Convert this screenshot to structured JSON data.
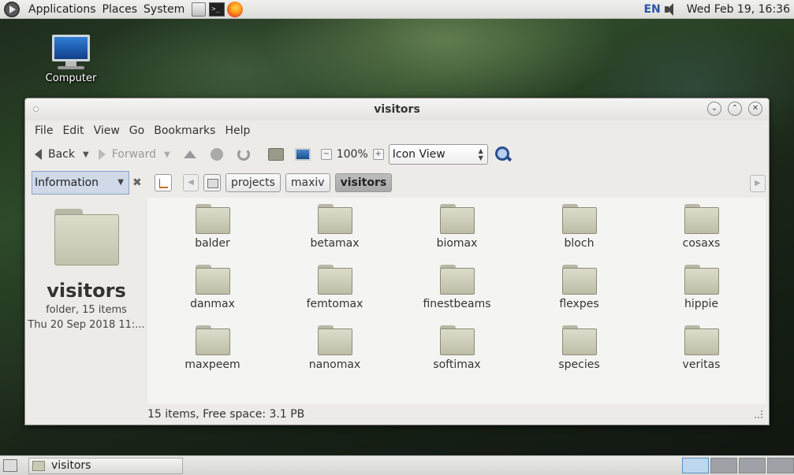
{
  "top_panel": {
    "menus": [
      "Applications",
      "Places",
      "System"
    ],
    "lang": "EN",
    "clock": "Wed Feb 19, 16:36"
  },
  "desktop": {
    "computer_label": "Computer"
  },
  "window": {
    "title": "visitors",
    "menubar": [
      "File",
      "Edit",
      "View",
      "Go",
      "Bookmarks",
      "Help"
    ],
    "toolbar": {
      "back": "Back",
      "forward": "Forward",
      "zoom": "100%",
      "view_mode": "Icon View"
    },
    "sidebar_mode": "Information",
    "breadcrumbs": [
      "projects",
      "maxiv",
      "visitors"
    ],
    "info": {
      "name": "visitors",
      "type": "folder, 15 items",
      "modified": "Thu 20 Sep 2018 11:..."
    },
    "items": [
      "balder",
      "betamax",
      "biomax",
      "bloch",
      "cosaxs",
      "danmax",
      "femtomax",
      "finestbeams",
      "flexpes",
      "hippie",
      "maxpeem",
      "nanomax",
      "softimax",
      "species",
      "veritas"
    ],
    "status": "15 items, Free space: 3.1 PB"
  },
  "bottom_panel": {
    "task_label": "visitors"
  },
  "colors": {
    "accent": "#5d8fc0",
    "selection": "#cfd9e8"
  }
}
